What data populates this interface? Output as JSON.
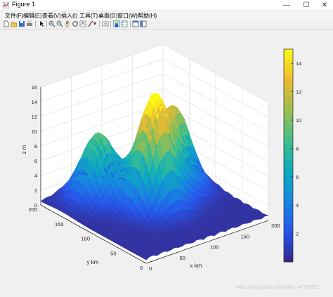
{
  "window": {
    "title": "Figure 1",
    "controls": {
      "minimize": "—",
      "maximize": "☐",
      "close": "✕"
    }
  },
  "menu": [
    "文件(F)",
    "编辑(E)",
    "查看(V)",
    "插入(I)",
    "工具(T)",
    "桌面(D)",
    "窗口(W)",
    "帮助(H)"
  ],
  "toolbar": {
    "icons": [
      "new-figure-icon",
      "open-file-icon",
      "save-icon",
      "print-icon",
      "edit-plot-icon",
      "zoom-in-icon",
      "zoom-out-icon",
      "pan-icon",
      "rotate-3d-icon",
      "data-cursor-icon",
      "brush-icon",
      "link-plot-icon",
      "colorbar-icon",
      "legend-icon",
      "hide-plot-tools-icon",
      "show-plot-tools-icon"
    ]
  },
  "watermark": "https://blog.csdn.net/weixin_47766011",
  "chart_data": {
    "type": "surface",
    "title": "",
    "xlabel": "x  km",
    "ylabel": "y  km",
    "zlabel": "z  m",
    "xlim": [
      0,
      200
    ],
    "ylim": [
      0,
      200
    ],
    "zlim": [
      0,
      16
    ],
    "x_ticks": [
      "0",
      "50",
      "100",
      "150",
      "200"
    ],
    "y_ticks": [
      "0",
      "50",
      "100",
      "150",
      "200"
    ],
    "z_ticks": [
      "0",
      "2",
      "4",
      "6",
      "8",
      "10",
      "12",
      "14",
      "16"
    ],
    "colorbar": {
      "ticks": [
        "2",
        "4",
        "6",
        "8",
        "10",
        "12",
        "14"
      ],
      "range": [
        0,
        15
      ],
      "colormap": "parula"
    },
    "grid": true,
    "peaks": [
      {
        "x": 60,
        "y": 160,
        "height": 9
      },
      {
        "x": 100,
        "y": 100,
        "height": 15
      },
      {
        "x": 150,
        "y": 120,
        "height": 11
      }
    ]
  }
}
